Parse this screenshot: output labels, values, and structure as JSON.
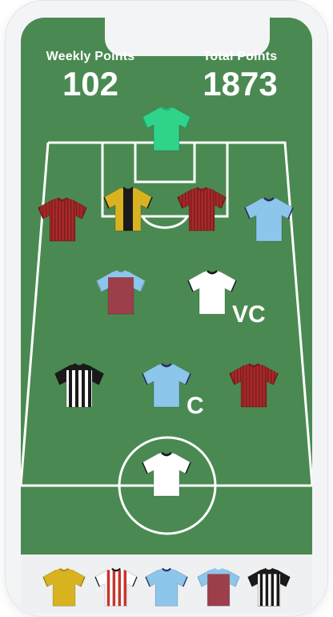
{
  "header": {
    "weekly_label": "Weekly Points",
    "weekly_value": "102",
    "total_label": "Total Points",
    "total_value": "1873"
  },
  "badges": {
    "vice_captain": "VC",
    "captain": "C"
  },
  "colors": {
    "pitch": "#4a8a52",
    "lines": "#ffffff",
    "mint": "#2fd48a",
    "maroon": "#a6292a",
    "sky": "#8cc6ea",
    "claret": "#9d3f4a",
    "yellow": "#d9b21f",
    "black": "#1a1a1a",
    "white": "#ffffff",
    "red": "#c8342c"
  },
  "players": [
    {
      "name": "goalkeeper-shirt",
      "style": "solid",
      "c1": "#2fd48a",
      "c2": "#2fd48a",
      "sleeve": "#2fd48a",
      "trim": "#27b875"
    },
    {
      "name": "defender-shirt-1",
      "style": "pinstripe",
      "c1": "#a6292a",
      "c2": "#7e1c1d",
      "sleeve": "#a6292a",
      "trim": "#7e1c1d"
    },
    {
      "name": "defender-shirt-2",
      "style": "bigstripe",
      "c1": "#d9b21f",
      "c2": "#1a1a1a",
      "sleeve": "#d9b21f",
      "trim": "#1a1a1a"
    },
    {
      "name": "defender-shirt-3",
      "style": "pinstripe",
      "c1": "#a6292a",
      "c2": "#7e1c1d",
      "sleeve": "#a6292a",
      "trim": "#7e1c1d"
    },
    {
      "name": "defender-shirt-4",
      "style": "solid",
      "c1": "#8cc6ea",
      "c2": "#8cc6ea",
      "sleeve": "#8cc6ea",
      "trim": "#2c2c6a"
    },
    {
      "name": "midfielder-shirt-1",
      "style": "solid",
      "c1": "#9d3f4a",
      "c2": "#9d3f4a",
      "sleeve": "#8cc6ea",
      "trim": "#8cc6ea"
    },
    {
      "name": "midfielder-shirt-2",
      "style": "solid",
      "c1": "#ffffff",
      "c2": "#ffffff",
      "sleeve": "#ffffff",
      "trim": "#1a1a1a"
    },
    {
      "name": "forward-shirt-1",
      "style": "stripes",
      "c1": "#ffffff",
      "c2": "#1a1a1a",
      "sleeve": "#1a1a1a",
      "trim": "#1a1a1a"
    },
    {
      "name": "forward-shirt-2",
      "style": "solid",
      "c1": "#8cc6ea",
      "c2": "#8cc6ea",
      "sleeve": "#8cc6ea",
      "trim": "#2c2c6a"
    },
    {
      "name": "forward-shirt-3",
      "style": "pinstripe",
      "c1": "#a6292a",
      "c2": "#7e1c1d",
      "sleeve": "#a6292a",
      "trim": "#7e1c1d"
    },
    {
      "name": "center-shirt",
      "style": "solid",
      "c1": "#ffffff",
      "c2": "#ffffff",
      "sleeve": "#ffffff",
      "trim": "#1a1a1a"
    }
  ],
  "bench": [
    {
      "name": "bench-shirt-1",
      "style": "solid",
      "c1": "#d9b21f",
      "c2": "#d9b21f",
      "sleeve": "#d9b21f",
      "trim": "#b08f14"
    },
    {
      "name": "bench-shirt-2",
      "style": "stripes",
      "c1": "#ffffff",
      "c2": "#c8342c",
      "sleeve": "#ffffff",
      "trim": "#1a1a1a"
    },
    {
      "name": "bench-shirt-3",
      "style": "solid",
      "c1": "#8cc6ea",
      "c2": "#8cc6ea",
      "sleeve": "#8cc6ea",
      "trim": "#2c2c6a"
    },
    {
      "name": "bench-shirt-4",
      "style": "solid",
      "c1": "#9d3f4a",
      "c2": "#9d3f4a",
      "sleeve": "#8cc6ea",
      "trim": "#8cc6ea"
    },
    {
      "name": "bench-shirt-5",
      "style": "stripes",
      "c1": "#ffffff",
      "c2": "#1a1a1a",
      "sleeve": "#1a1a1a",
      "trim": "#1a1a1a"
    }
  ]
}
